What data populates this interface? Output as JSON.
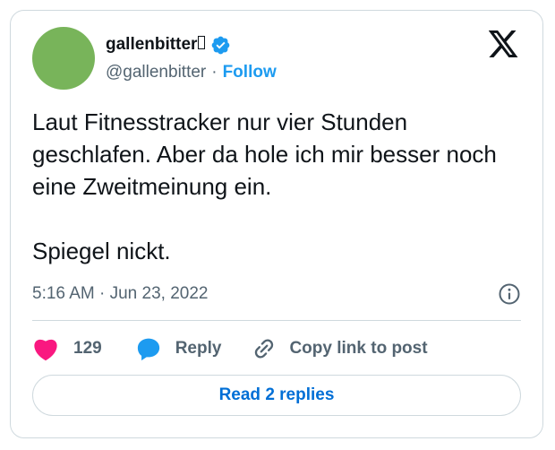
{
  "author": {
    "display_name": "gallenbitter",
    "handle": "@gallenbitter",
    "verified": true,
    "avatar_color": "#78b45a"
  },
  "header": {
    "separator": "·",
    "follow_label": "Follow",
    "platform_icon": "x-logo-icon"
  },
  "tweet": {
    "paragraphs": [
      "Laut Fitnesstracker nur vier Stunden geschlafen. Aber da hole ich mir besser noch eine Zweitmeinung ein.",
      "Spiegel nickt."
    ],
    "timestamp": "5:16 AM · Jun 23, 2022"
  },
  "actions": {
    "like_count": "129",
    "reply_label": "Reply",
    "copy_link_label": "Copy link to post"
  },
  "footer": {
    "read_replies_label": "Read 2 replies"
  },
  "colors": {
    "accent": "#1d9bf0",
    "like": "#f91880",
    "muted_text": "#536471",
    "border": "#cfd9de"
  }
}
